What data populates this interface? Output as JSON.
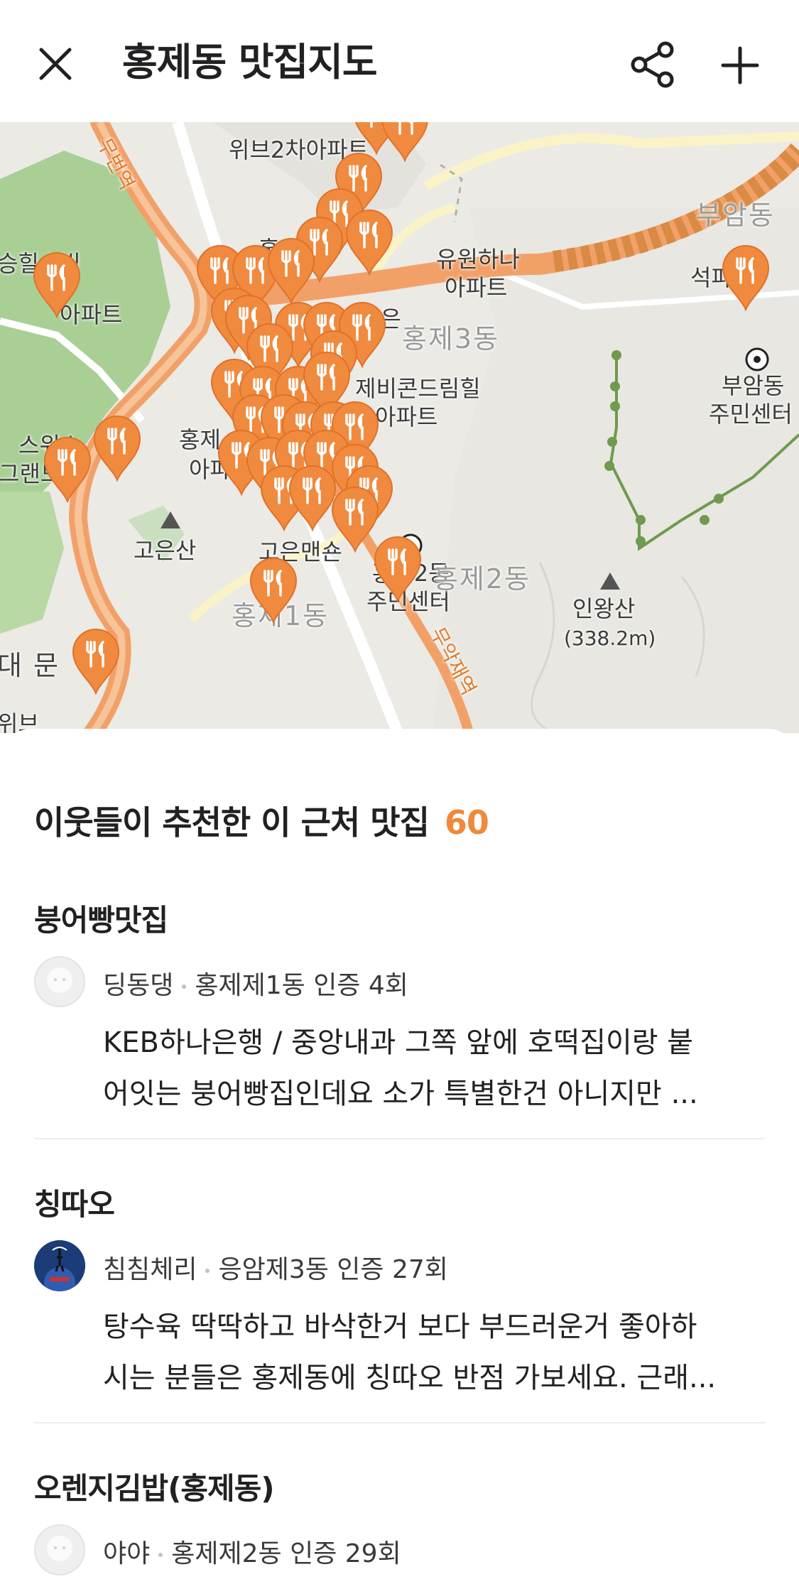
{
  "header": {
    "title": "홍제동 맛집지도"
  },
  "map": {
    "labels": {
      "wib": "위브2차아파트",
      "hongeun": "홍은",
      "hongeun2": "홍은",
      "yuwon": "유원하나",
      "apt": "아파트",
      "hongje3": "홍제3동",
      "bueamdong_faint": "부암동",
      "seokpa": "석파",
      "bueam_center1": "부암동",
      "bueam_center2": "주민센터",
      "hill1": "승힐스빌",
      "hill2": "아파트",
      "evercon1": "제비콘드림힐",
      "evercon2": "아파트",
      "swiss1": "스위스",
      "swiss2": "그랜드",
      "hongje_apt1": "홍제",
      "hongje_apt2": "아파",
      "goeunsan": "고은산",
      "goeun_mansion": "고은맨숀",
      "hongje2_center1": "홍제2동",
      "hongje2_center2": "주민센터",
      "hongje2_faint": "홍제2동",
      "inwangsan": "인왕산",
      "inwang_height": "(338.2m)",
      "hongje1_faint": "홍제1동",
      "daemun": "대 문",
      "road_muak": "무악재역",
      "road_top": "무번역",
      "wib_bottom": "위브"
    }
  },
  "sheet": {
    "heading": "이웃들이 추천한 이 근처 맛집",
    "count": "60",
    "items": [
      {
        "name": "붕어빵맛집",
        "user": "딩동댕",
        "location": "홍제제1동 인증 4회",
        "desc_line1": "KEB하나은행 / 중앙내과 그쪽 앞에 호떡집이랑 붙",
        "desc_line2": "어잇는 붕어빵집인데요 소가 특별한건 아니지만 ..."
      },
      {
        "name": "칭따오",
        "user": "침침체리",
        "location": "응암제3동 인증 27회",
        "desc_line1": "탕수육 딱딱하고 바삭한거 보다 부드러운거 좋아하",
        "desc_line2": "시는 분들은 홍제동에 칭따오 반점 가보세요. 근래..."
      },
      {
        "name": "오렌지김밥(홍제동)",
        "user": "야야",
        "location": "홍제제2동 인증 29회",
        "desc_line1": "",
        "desc_line2": ""
      }
    ]
  },
  "colors": {
    "accent": "#f0893b",
    "pin": "#f08a3e",
    "road": "#f0a060",
    "park": "#a7cf93"
  }
}
